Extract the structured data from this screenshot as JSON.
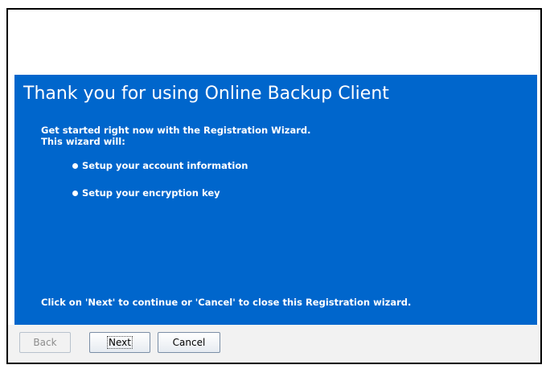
{
  "wizard": {
    "headline": "Thank you for using Online Backup Client",
    "intro_line1": "Get started right now with the Registration Wizard.",
    "intro_line2": "This wizard will:",
    "steps": [
      "Setup your account information",
      "Setup your encryption key"
    ],
    "footer_note": "Click on 'Next' to continue or 'Cancel' to close this Registration wizard.",
    "panel_color": "#0066cc"
  },
  "buttons": {
    "back": "Back",
    "next": "Next",
    "cancel": "Cancel"
  }
}
